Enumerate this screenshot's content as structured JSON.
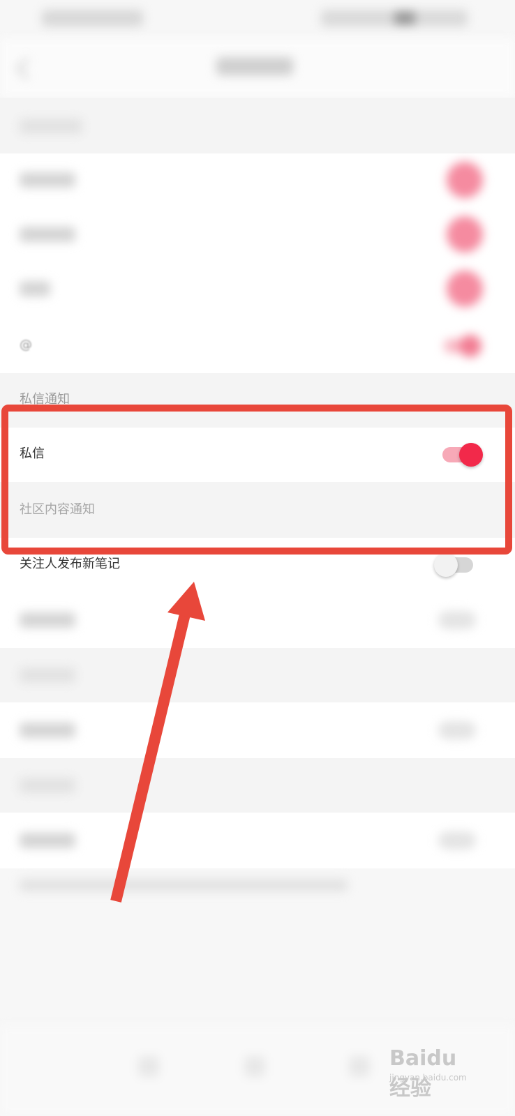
{
  "dm_section": {
    "title": "私信通知"
  },
  "rows": {
    "at_label": "@",
    "dm_label": "私信",
    "community_label": "社区内容通知",
    "follow_label": "关注人发布新笔记"
  },
  "toggles": {
    "dm_enabled": true,
    "follow_enabled": false
  },
  "colors": {
    "accent": "#f2294a",
    "highlight": "#e8473a"
  },
  "watermark": {
    "brand": "Baidu 经验",
    "url": "jingyan.baidu.com"
  }
}
